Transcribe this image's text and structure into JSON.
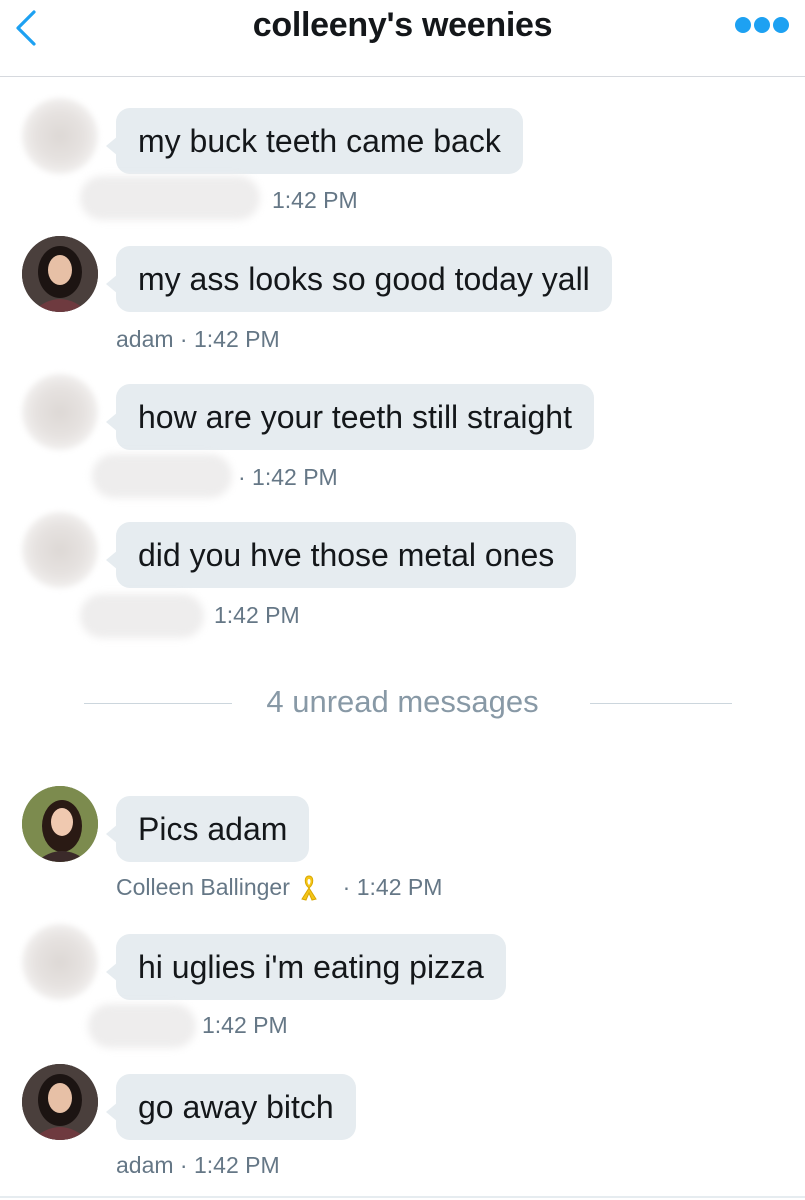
{
  "header": {
    "title": "colleeny's weenies",
    "back_icon": "chevron-left-icon",
    "more_icon": "more-dots-icon",
    "accent_color": "#1da1f2"
  },
  "messages": [
    {
      "text": "my buck teeth came back",
      "meta": "1:42 PM",
      "sender_visible": false
    },
    {
      "text": "my ass looks so good today yall",
      "meta": "adam · 1:42 PM",
      "sender_visible": true
    },
    {
      "text": "how are your teeth still straight",
      "meta": "· 1:42 PM",
      "sender_visible": false
    },
    {
      "text": "did you hve those metal ones",
      "meta": "1:42 PM",
      "sender_visible": false
    },
    {
      "text": "Pics adam",
      "meta_name": "Colleen Ballinger",
      "meta_badge_icon": "yellow-ribbon-icon",
      "meta_time": "· 1:42 PM",
      "sender_visible": true
    },
    {
      "text": "hi uglies i'm eating pizza",
      "meta": "1:42 PM",
      "sender_visible": false
    },
    {
      "text": "go away bitch",
      "meta": "adam · 1:42 PM",
      "sender_visible": true
    }
  ],
  "unread_divider": {
    "label": "4 unread messages"
  },
  "colors": {
    "bubble_bg": "#e6ecf0",
    "meta_text": "#657786",
    "unread_text": "#8899a6",
    "ribbon": "#f5c518"
  }
}
